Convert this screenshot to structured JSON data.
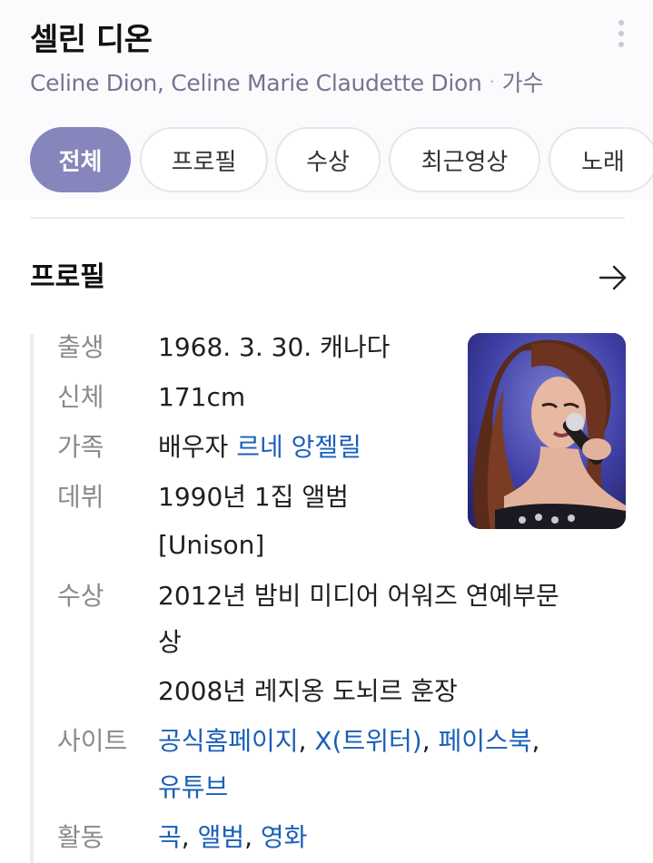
{
  "header": {
    "title": "셀린 디온",
    "subtitle_names": "Celine Dion, Celine Marie Claudette Dion",
    "subtitle_dot": "·",
    "subtitle_role": "가수",
    "more_icon": "more-vertical-icon"
  },
  "tabs": [
    {
      "label": "전체",
      "active": true
    },
    {
      "label": "프로필",
      "active": false
    },
    {
      "label": "수상",
      "active": false
    },
    {
      "label": "최근영상",
      "active": false
    },
    {
      "label": "노래",
      "active": false
    }
  ],
  "profile": {
    "section_title": "프로필",
    "arrow_icon": "arrow-right-icon",
    "birth": {
      "label": "출생",
      "value": "1968. 3. 30. 캐나다"
    },
    "body": {
      "label": "신체",
      "value": "171cm"
    },
    "family": {
      "label": "가족",
      "prefix": "배우자 ",
      "link": "르네 앙젤릴"
    },
    "debut": {
      "label": "데뷔",
      "line1": "1990년 1집 앨범",
      "line2": "[Unison]"
    },
    "awards": {
      "label": "수상",
      "line1": "2012년 밤비 미디어 어워즈 연예부문",
      "line2": "상",
      "line3": "2008년 레지옹 도뇌르 훈장"
    },
    "site": {
      "label": "사이트",
      "link1": "공식홈페이지",
      "sep1": ", ",
      "link2": "X(트위터)",
      "sep2": ", ",
      "link3": "페이스북",
      "sep3": ",",
      "link4": "유튜브"
    },
    "activity": {
      "label": "활동",
      "link1": "곡",
      "sep1": ", ",
      "link2": "앨범",
      "sep2": ", ",
      "link3": "영화"
    }
  },
  "colors": {
    "accent": "#8686bd",
    "link": "#1a5fb8",
    "label": "#8a8a8a"
  }
}
